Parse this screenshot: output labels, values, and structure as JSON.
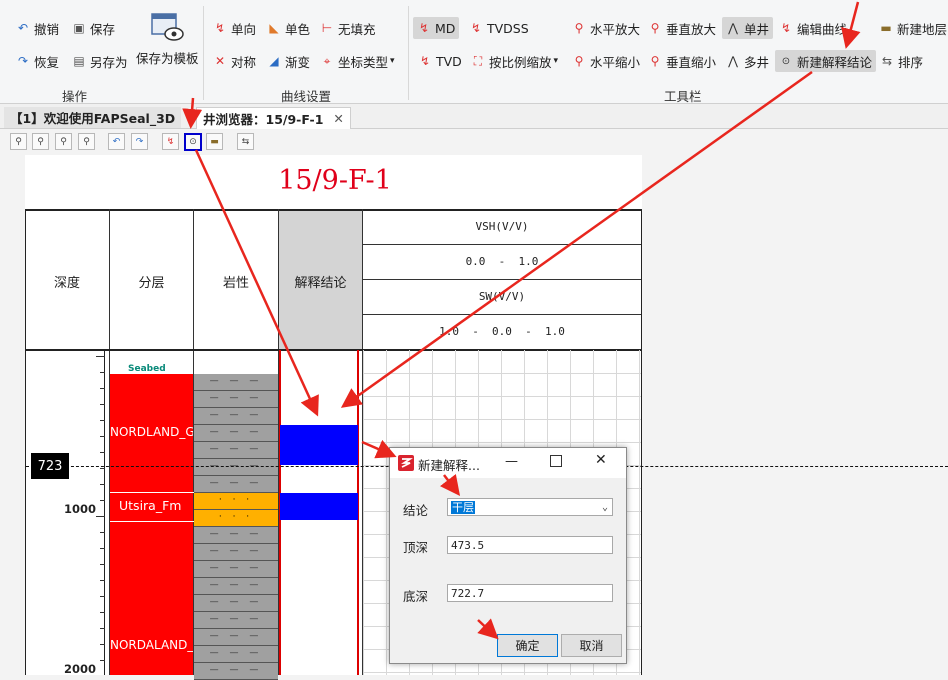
{
  "ribbon": {
    "operation": {
      "undo": "撤销",
      "save": "保存",
      "redo": "恢复",
      "save_as": "另存为",
      "save_template": "保存为模板",
      "label": "操作"
    },
    "curve": {
      "one_way": "单向",
      "single_color": "单色",
      "no_fill": "无填充",
      "symmetric": "对称",
      "gradient": "渐变",
      "coord_type": "坐标类型",
      "label": "曲线设置"
    },
    "tools": {
      "md": "MD",
      "tvdss": "TVDSS",
      "h_zoom_in": "水平放大",
      "v_zoom_in": "垂直放大",
      "single_well": "单井",
      "edit_curve": "编辑曲线",
      "new_layer": "新建地层",
      "tvd": "TVD",
      "scale_zoom": "按比例缩放",
      "h_zoom_out": "水平缩小",
      "v_zoom_out": "垂直缩小",
      "multi_well": "多井",
      "new_interp": "新建解释结论",
      "sort": "排序",
      "label": "工具栏"
    }
  },
  "tabs": [
    {
      "label": "【1】欢迎使用FAPSeal_3D"
    },
    {
      "label": "井浏览器：15/9-F-1"
    }
  ],
  "log": {
    "title": "15/9-F-1",
    "columns": {
      "depth": "深度",
      "layer": "分层",
      "lithology": "岩性",
      "interp": "解释结论"
    },
    "curve_header": {
      "vsh_name": "VSH(V/V)",
      "vsh_range": "0.0  -  1.0",
      "sw_name": "SW(V/V)",
      "sw_range": "1.0  -  0.0  -  1.0"
    },
    "layers": {
      "top_small": "Seabed",
      "nordland": "NORDLAND_GP",
      "utsira": "Utsira_Fm",
      "nordaland2": "NORDALAND_GP"
    },
    "depth_labels": {
      "d1000": "1000",
      "d2000": "2000"
    },
    "cursor_depth": "723",
    "colors": {
      "layer_red": "#ff0000",
      "interp_blue": "#0000ff",
      "sand_orange": "#ffb000",
      "shale_gray": "#a0a0a0"
    }
  },
  "dialog": {
    "title": "新建解释...",
    "conclusion_label": "结论",
    "conclusion_value": "干层",
    "top_label": "顶深",
    "top_value": "473.5",
    "bottom_label": "底深",
    "bottom_value": "722.7",
    "ok": "确定",
    "cancel": "取消"
  }
}
